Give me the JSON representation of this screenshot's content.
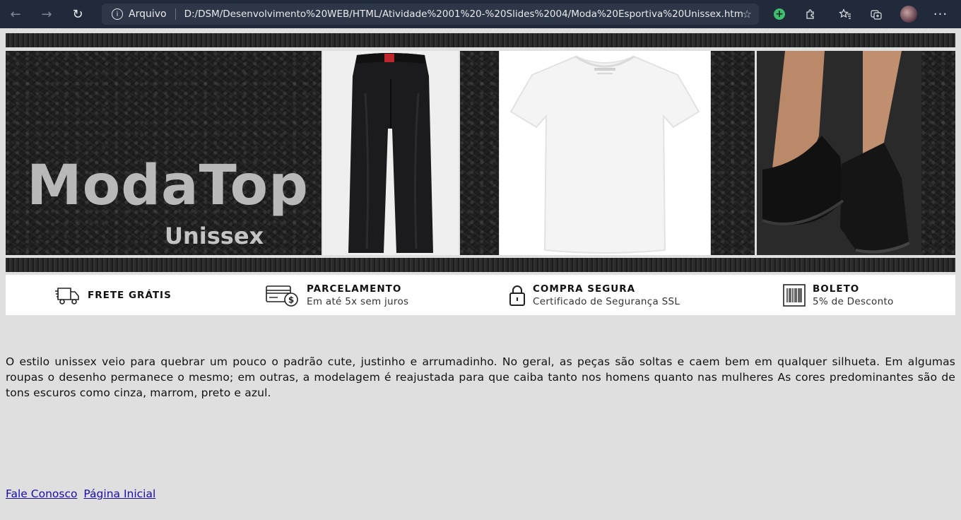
{
  "browser": {
    "scheme_label": "Arquivo",
    "url": "D:/DSM/Desenvolvimento%20WEB/HTML/Atividade%2001%20-%20Slides%2004/Moda%20Esportiva%20Unissex.html"
  },
  "banner": {
    "brand": "ModaTop",
    "sub": "Unissex"
  },
  "features": [
    {
      "title": "FRETE GRÁTIS",
      "subtitle": "",
      "icon": "truck-icon"
    },
    {
      "title": "PARCELAMENTO",
      "subtitle": "Em até 5x sem juros",
      "icon": "card-payment-icon"
    },
    {
      "title": "COMPRA SEGURA",
      "subtitle": "Certificado de Segurança SSL",
      "icon": "lock-icon"
    },
    {
      "title": "BOLETO",
      "subtitle": "5% de Desconto",
      "icon": "barcode-icon"
    }
  ],
  "main": {
    "paragraph": "O estilo unissex veio para quebrar um pouco o padrão cute, justinho e arrumadinho. No geral, as peças são soltas e caem bem em qualquer silhueta. Em algumas roupas o desenho permanece o mesmo; em outras, a modelagem é reajustada para que caiba tanto nos homens quanto nas mulheres As cores predominantes são de tons escuros como cinza, marrom, preto e azul."
  },
  "footer": {
    "contact_link": "Fale Conosco",
    "home_link": "Página Inicial"
  },
  "colors": {
    "page_bg": "#dfdfdf",
    "chrome_bg": "#202a3a",
    "link": "#1a0dab"
  }
}
